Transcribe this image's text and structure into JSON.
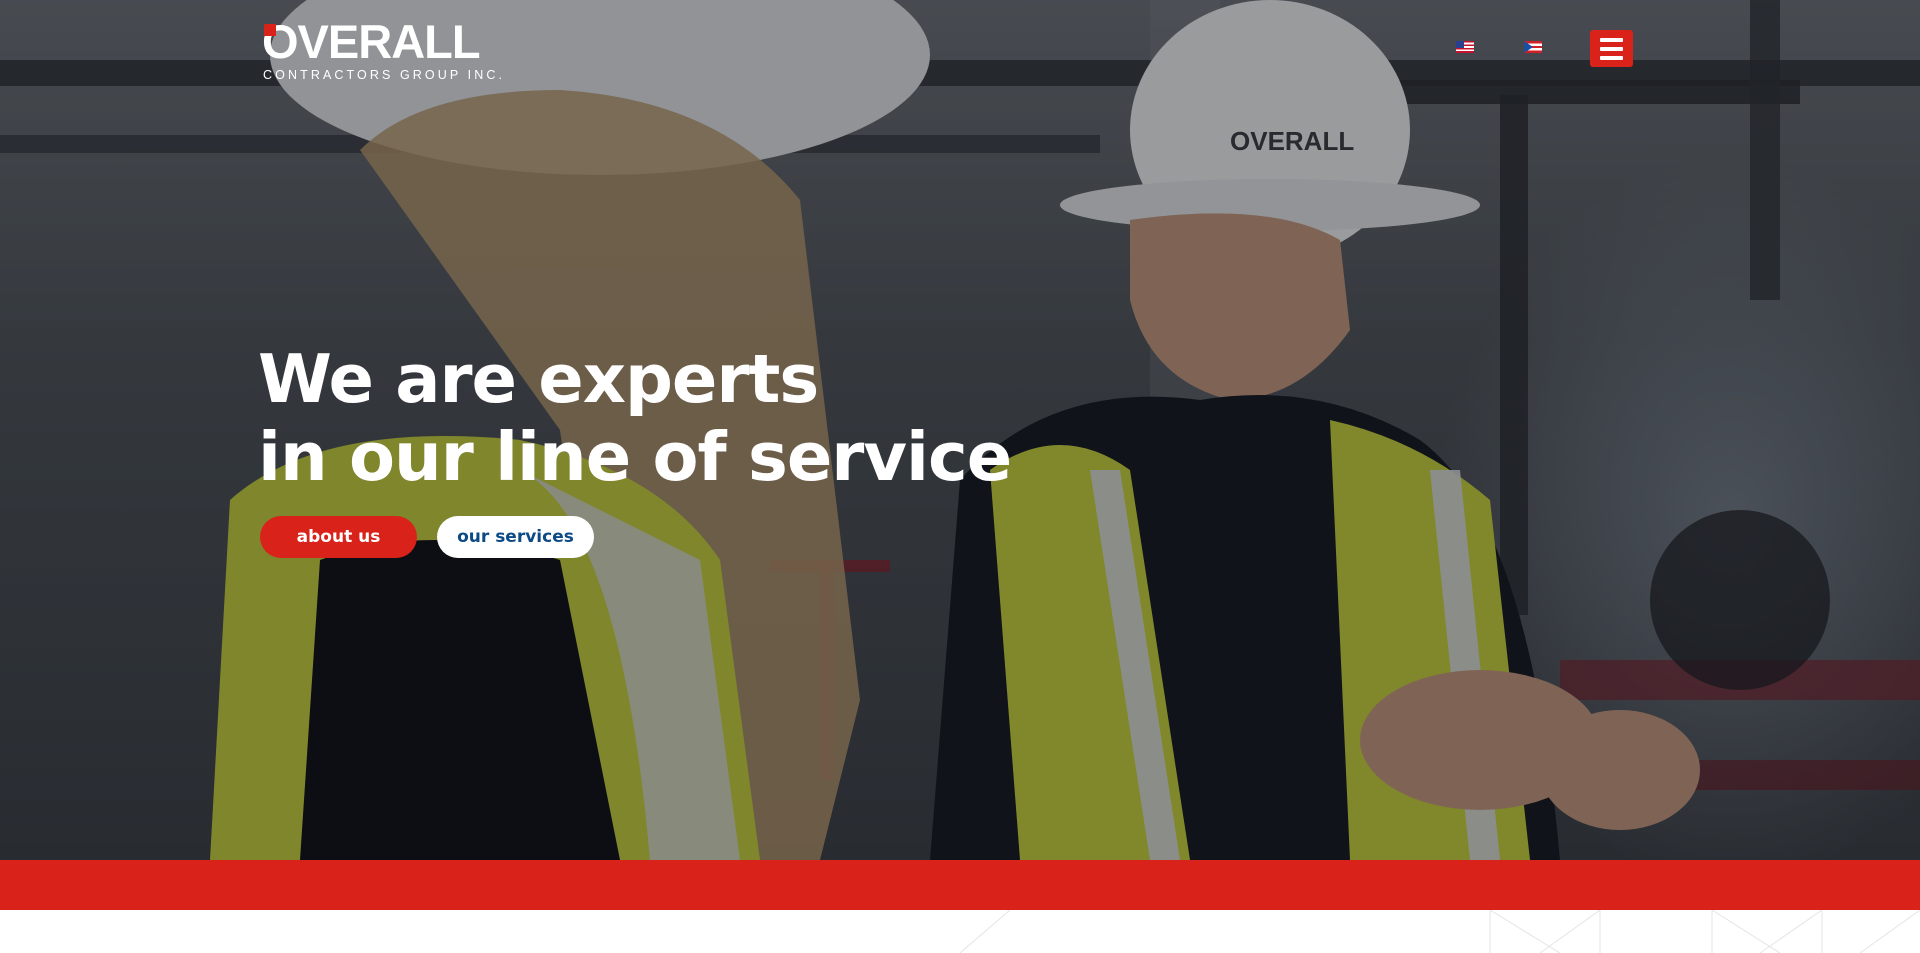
{
  "brand": {
    "name": "OVERALL",
    "tagline": "CONTRACTORS GROUP INC."
  },
  "header": {
    "languages": [
      {
        "name": "English",
        "icon": "us-flag-icon"
      },
      {
        "name": "Español",
        "icon": "puerto-rico-flag-icon"
      }
    ],
    "menu_icon": "hamburger-menu-icon"
  },
  "hero": {
    "headline_line1": "We are experts",
    "headline_line2": "in our line of service",
    "primary_button": "about us",
    "secondary_button": "our services",
    "background": "construction workers in hard hats and safety vests"
  },
  "colors": {
    "accent": "#d9231a",
    "secondary_text": "#0d4a86",
    "white": "#ffffff"
  }
}
